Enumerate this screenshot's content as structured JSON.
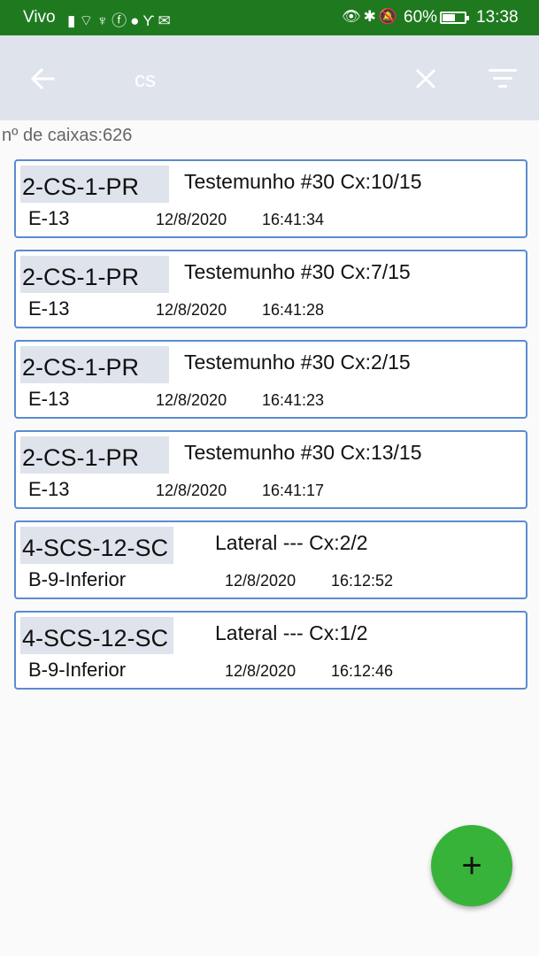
{
  "status_bar": {
    "carrier": "Vivo",
    "left_icons": "signal-icon wifi-icon usb-icon facebook-icon globe-icon y-icon mail-icon",
    "right_icons": "eye-icon bluetooth-icon mute-icon",
    "battery_pct": "60%",
    "battery_level": 0.6,
    "time": "13:38"
  },
  "toolbar": {
    "search_value": "cs",
    "back_icon": "arrow-left-icon",
    "clear_icon": "close-icon",
    "filter_icon": "filter-icon"
  },
  "count_label": "nº de caixas:626",
  "items": [
    {
      "code": "2-CS-1-PR",
      "desc": "Testemunho #30 Cx:10/15",
      "loc": "E-13",
      "date": "12/8/2020",
      "time": "16:41:34"
    },
    {
      "code": "2-CS-1-PR",
      "desc": "Testemunho #30 Cx:7/15",
      "loc": "E-13",
      "date": "12/8/2020",
      "time": "16:41:28"
    },
    {
      "code": "2-CS-1-PR",
      "desc": "Testemunho #30 Cx:2/15",
      "loc": "E-13",
      "date": "12/8/2020",
      "time": "16:41:23"
    },
    {
      "code": "2-CS-1-PR",
      "desc": "Testemunho #30 Cx:13/15",
      "loc": "E-13",
      "date": "12/8/2020",
      "time": "16:41:17"
    },
    {
      "code": "4-SCS-12-SC",
      "desc": "Lateral --- Cx:2/2",
      "loc": "B-9-Inferior",
      "date": "12/8/2020",
      "time": "16:12:52"
    },
    {
      "code": "4-SCS-12-SC",
      "desc": "Lateral --- Cx:1/2",
      "loc": "B-9-Inferior",
      "date": "12/8/2020",
      "time": "16:12:46"
    }
  ],
  "fab": {
    "label": "+",
    "color": "#38b33a"
  },
  "colors": {
    "status_bar": "#1f7a1f",
    "toolbar": "#dfe3ec",
    "card_border": "#5b8ccf"
  }
}
